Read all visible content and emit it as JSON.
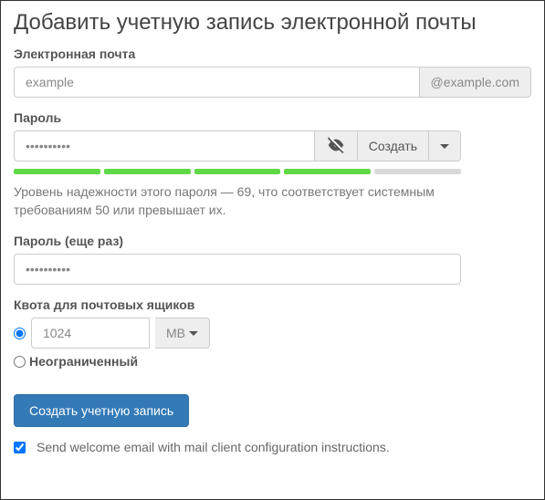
{
  "title": "Добавить учетную запись электронной почты",
  "labels": {
    "email": "Электронная почта",
    "password": "Пароль",
    "password2": "Пароль (еще раз)",
    "quota": "Квота для почтовых ящиков"
  },
  "email": {
    "value": "example",
    "domain": "@example.com"
  },
  "password": {
    "value": "••••••••••",
    "generate_label": "Создать",
    "strength_on": 4,
    "strength_total": 5,
    "hint": "Уровень надежности этого пароля — 69, что соответствует системным требованиям 50 или превышает их."
  },
  "password2": {
    "value": "••••••••••"
  },
  "quota": {
    "selected": "fixed",
    "value": "1024",
    "unit": "MB",
    "unlimited_label": "Неограниченный"
  },
  "submit_label": "Создать учетную запись",
  "welcome": {
    "checked": true,
    "label": "Send welcome email with mail client configuration instructions."
  }
}
